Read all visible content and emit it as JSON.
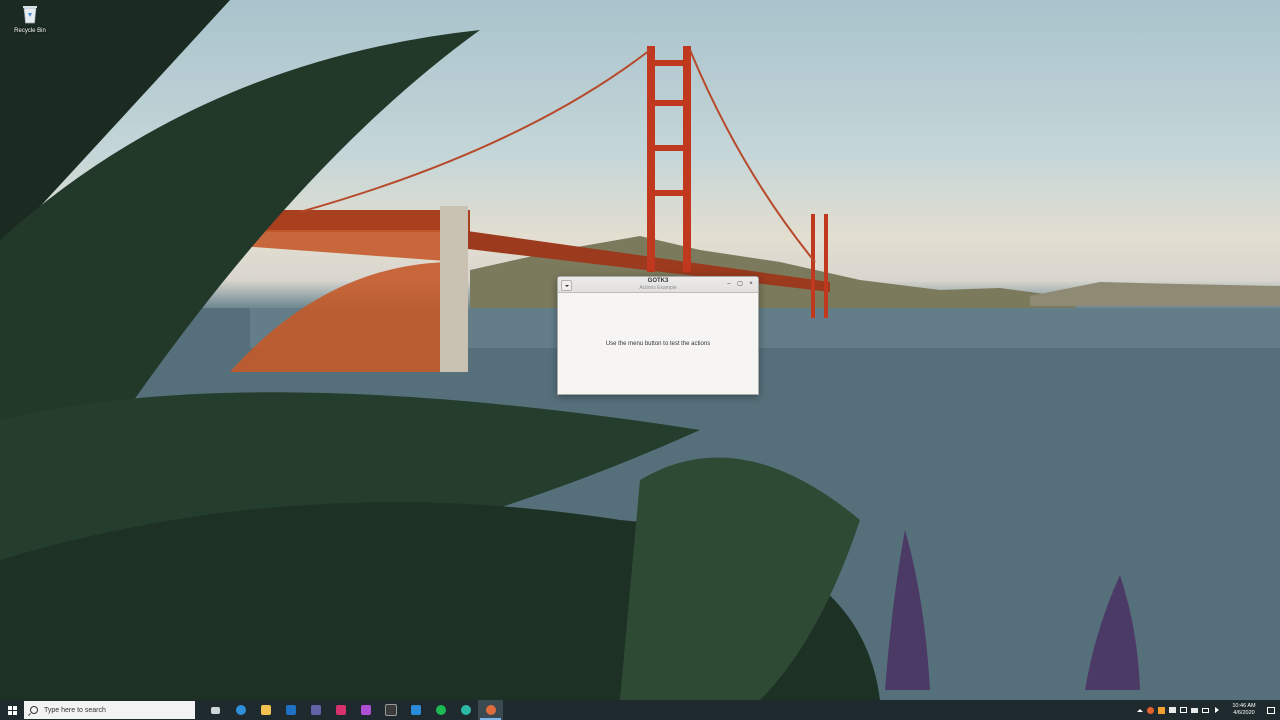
{
  "desktop": {
    "icons": [
      {
        "label": "Recycle Bin",
        "icon": "recycle-bin-icon"
      }
    ]
  },
  "window": {
    "title": "GOTK3",
    "subtitle": "Actions Example",
    "body_text": "Use the menu button to test the actions",
    "controls": {
      "minimize": "–",
      "maximize": "▢",
      "close": "×"
    }
  },
  "taskbar": {
    "search_placeholder": "Type here to search",
    "apps": [
      {
        "name": "task-view-icon",
        "color": "#cfd6d9"
      },
      {
        "name": "edge-icon",
        "color": "#2f8fd8"
      },
      {
        "name": "file-explorer-icon",
        "color": "#f2c14e"
      },
      {
        "name": "outlook-icon",
        "color": "#1f6fc2"
      },
      {
        "name": "teams-icon",
        "color": "#6264a7"
      },
      {
        "name": "jetbrains-icon",
        "color": "#d6336c"
      },
      {
        "name": "datagrip-icon",
        "color": "#b04fd6"
      },
      {
        "name": "terminal-icon",
        "color": "#3b3b3b"
      },
      {
        "name": "vscode-icon",
        "color": "#2a8bd6"
      },
      {
        "name": "spotify-icon",
        "color": "#1db954"
      },
      {
        "name": "edge-beta-icon",
        "color": "#2db8a5"
      },
      {
        "name": "gtk-app-icon",
        "color": "#e06c3c",
        "active": true
      }
    ],
    "tray": [
      "chevron-up-icon",
      "app-tray-icon-1",
      "app-tray-icon-2",
      "app-tray-icon-3",
      "battery-icon",
      "network-icon",
      "monitor-icon",
      "volume-icon"
    ],
    "clock": {
      "time": "10:46 AM",
      "date": "4/6/2020"
    }
  }
}
